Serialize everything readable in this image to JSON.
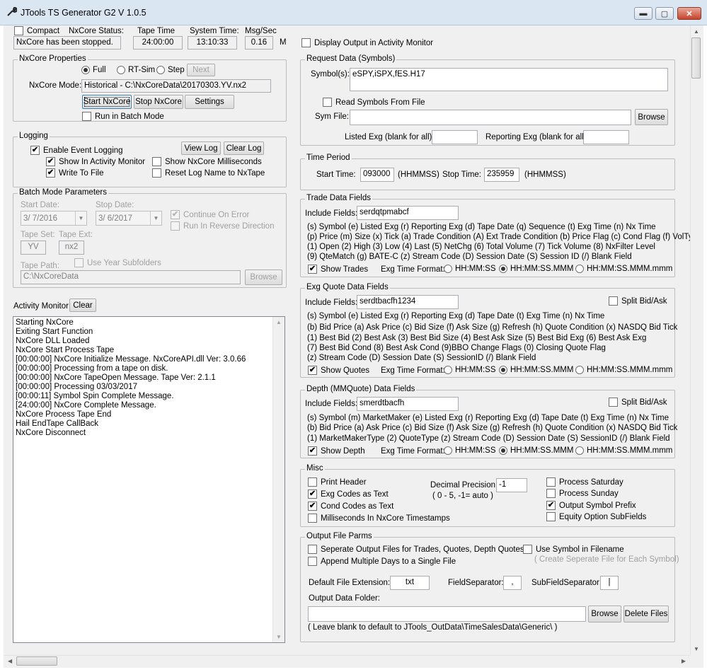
{
  "window": {
    "title": "JTools TS Generator G2 V 1.0.5",
    "min": "▬",
    "max": "▢",
    "close": "✕"
  },
  "top": {
    "compact": "Compact",
    "nxcore_status_label": "NxCore Status:",
    "nxcore_status": "NxCore has been stopped.",
    "tape_time_label": "Tape Time",
    "tape_time": "24:00:00",
    "system_time_label": "System Time:",
    "system_time": "13:10:33",
    "msg_label": "Msg/Sec",
    "msg_value": "0.16",
    "msg_unit": "M",
    "display_output": "Display Output in Activity Monitor"
  },
  "props": {
    "caption": "NxCore Properties",
    "full": "Full",
    "rtsim": "RT-Sim",
    "step": "Step",
    "next": "Next",
    "mode_label": "NxCore Mode:",
    "mode_value": "Historical - C:\\NxCoreData\\20170303.YV.nx2",
    "start": "Start NxCore",
    "stop": "Stop NxCore",
    "settings": "Settings",
    "batch": "Run in Batch Mode"
  },
  "logging": {
    "caption": "Logging",
    "enable": "Enable Event Logging",
    "view": "View Log",
    "clear": "Clear Log",
    "show_monitor": "Show In Activity Monitor",
    "show_ms": "Show NxCore Milliseconds",
    "write_file": "Write To File",
    "reset_log": "Reset Log Name to NxTape"
  },
  "batch": {
    "caption": "Batch Mode Parameters",
    "start_label": "Start Date:",
    "stop_label": "Stop Date:",
    "start": "3/ 7/2016",
    "stop": "3/ 6/2017",
    "continue": "Continue On Error",
    "reverse": "Run In Reverse Direction",
    "tapeset_label": "Tape Set:",
    "tapeext_label": "Tape Ext:",
    "tapeset": "YV",
    "tapeext": "nx2",
    "yearsub": "Use Year Subfolders",
    "path_label": "Tape Path:",
    "path": "C:\\NxCoreData",
    "browse": "Browse"
  },
  "activity": {
    "label": "Activity Monitor:",
    "clear": "Clear",
    "lines": [
      "Starting NxCore",
      "Exiting Start Function",
      "NxCore DLL Loaded",
      "NxCore Start Process Tape",
      "[00:00:00] NxCore Initialize Message. NxCoreAPI.dll Ver: 3.0.66",
      "[00:00:00] Processing from a tape on disk.",
      "[00:00:00] NxCore TapeOpen Message. Tape Ver: 2.1.1",
      "[00:00:00] Processing 03/03/2017",
      "[00:00:11] Symbol Spin Complete Message.",
      "[24:00:00] NxCore Complete Message.",
      "NxCore Process Tape End",
      "Hail EndTape CallBack",
      "NxCore Disconnect"
    ]
  },
  "request": {
    "caption": "Request Data (Symbols)",
    "symbols_label": "Symbol(s):",
    "symbols": "eSPY,iSPX,fES.H17",
    "read_file": "Read Symbols From File",
    "symfile_label": "Sym File:",
    "browse": "Browse",
    "listed_label": "Listed Exg (blank for all):",
    "reporting_label": "Reporting Exg (blank for all):"
  },
  "time": {
    "caption": "Time Period",
    "start_label": "Start Time:",
    "start": "093000",
    "fmt": "(HHMMSS)",
    "stop_label": "Stop Time:",
    "stop": "235959"
  },
  "trade": {
    "caption": "Trade Data Fields",
    "include_label": "Include Fields:",
    "include": "serdqtpmabcf",
    "lines": [
      "(s) Symbol (e) Listed Exg (r) Reporting Exg (d) Tape Date (q) Sequence (t) Exg Time (n) Nx Time",
      "(p) Price (m) Size (x) Tick (a) Trade Condition (A) Ext Trade Condition (b) Price Flag (c) Cond Flag (f) VolType",
      "(1) Open (2) High (3) Low (4) Last (5) NetChg (6) Total Volume (7) Tick Volume (8) NxFilter Level",
      "(9) QteMatch (g) BATE-C (z) Stream Code (D) Session Date (S) Session ID (/) Blank Field"
    ],
    "show": "Show Trades"
  },
  "fmt": {
    "label": "Exg Time Format:",
    "o1": "HH:MM:SS",
    "o2": "HH:MM:SS.MMM",
    "o3": "HH:MM:SS.MMM.mmm"
  },
  "quote": {
    "caption": "Exg Quote Data Fields",
    "include_label": "Include Fields:",
    "include": "serdtbacfh1234",
    "split": "Split Bid/Ask",
    "lines": [
      "(s) Symbol (e) Listed Exg (r) Reporting Exg (d) Tape Date (t) Exg Time (n) Nx Time",
      "(b) Bid Price (a) Ask Price (c) Bid Size (f) Ask Size (g) Refresh (h) Quote Condition (x) NASDQ Bid Tick",
      "(1) Best Bid (2) Best Ask (3) Best Bid Size (4) Best Ask Size (5) Best Bid Exg (6) Best Ask Exg",
      "(7) Best Bid Cond (8) Best Ask Cond (9)BBO Change Flags (0) Closing Quote Flag",
      "(z) Stream Code (D) Session Date (S) SessionID (/) Blank Field"
    ],
    "show": "Show Quotes"
  },
  "depth": {
    "caption": "Depth (MMQuote) Data Fields",
    "include_label": "Include Fields:",
    "include": "smerdtbacfh",
    "split": "Split Bid/Ask",
    "lines": [
      "(s) Symbol (m) MarketMaker (e) Listed Exg (r) Reporting Exg (d) Tape Date (t) Exg Time (n) Nx Time",
      "(b) Bid Price (a) Ask Price (c) Bid Size (f) Ask Size (g) Refresh (h) Quote Condition (x) NASDQ Bid Tick",
      "(1) MarketMakerType (2) QuoteType (z) Stream Code (D) Session Date (S) SessionID (/) Blank Field"
    ],
    "show": "Show Depth"
  },
  "misc": {
    "caption": "Misc",
    "print_header": "Print Header",
    "exg_codes": "Exg Codes as Text",
    "cond_codes": "Cond Codes as Text",
    "ms_ts": "Milliseconds In NxCore Timestamps",
    "decimal_label": "Decimal Precision:",
    "decimal": "-1",
    "decimal_hint": "( 0 - 5, -1= auto )",
    "sat": "Process Saturday",
    "sun": "Process Sunday",
    "prefix": "Output Symbol Prefix",
    "equity": "Equity Option SubFields"
  },
  "output": {
    "caption": "Output File Parms",
    "separate": "Seperate Output Files for Trades, Quotes, Depth Quotes",
    "use_symbol": "Use Symbol in Filename",
    "use_symbol_hint": "( Create Seperate File for Each Symbol)",
    "append": "Append Multiple Days to a Single File",
    "ext_label": "Default File Extension:",
    "ext": "txt",
    "fieldsep_label": "FieldSeparator:",
    "fieldsep": ",",
    "subsep_label": "SubFieldSeparator:",
    "subsep": "|",
    "folder_label": "Output Data Folder:",
    "browse": "Browse",
    "delete": "Delete Files",
    "hint": "( Leave blank to default to JTools_OutData\\TimeSalesData\\Generic\\ )"
  },
  "checks": {
    "mark": "✔"
  }
}
